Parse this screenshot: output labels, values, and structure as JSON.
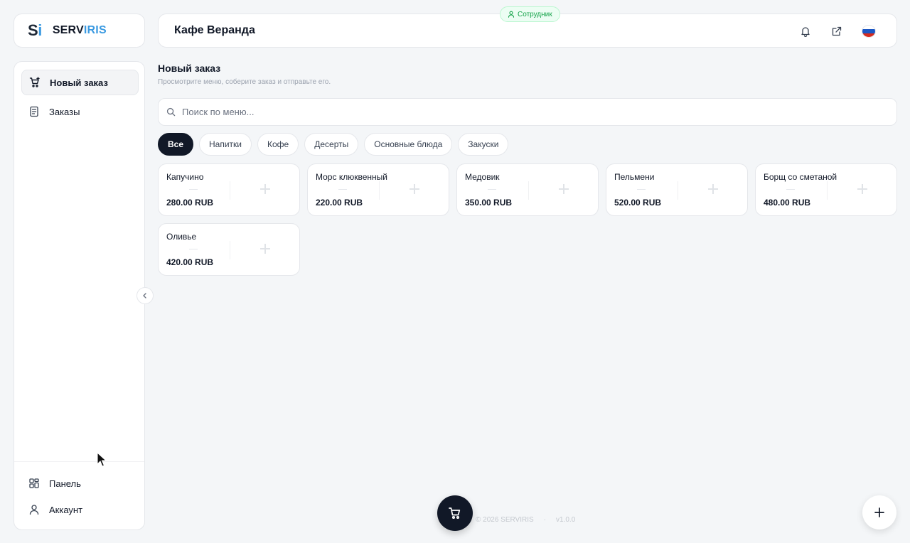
{
  "brand": {
    "mark_s": "S",
    "mark_i": "i",
    "name_a": "SERV",
    "name_b": "IRIS",
    "accent": "#3b9ae1"
  },
  "sidebar": {
    "items": [
      {
        "label": "Новый заказ",
        "icon": "cart-plus-icon",
        "active": true
      },
      {
        "label": "Заказы",
        "icon": "receipt-icon",
        "active": false
      }
    ],
    "bottom_items": [
      {
        "label": "Панель",
        "icon": "dashboard-icon"
      },
      {
        "label": "Аккаунт",
        "icon": "user-icon"
      }
    ]
  },
  "header": {
    "title": "Кафе Веранда",
    "role_badge": "Сотрудник",
    "icons": [
      "bell-icon",
      "external-link-icon",
      "russia-flag-icon"
    ]
  },
  "page": {
    "title": "Новый заказ",
    "subtitle": "Просмотрите меню, соберите заказ и отправьте его."
  },
  "search": {
    "placeholder": "Поиск по меню...",
    "value": ""
  },
  "categories": [
    {
      "label": "Все",
      "active": true
    },
    {
      "label": "Напитки",
      "active": false
    },
    {
      "label": "Кофе",
      "active": false
    },
    {
      "label": "Десерты",
      "active": false
    },
    {
      "label": "Основные блюда",
      "active": false
    },
    {
      "label": "Закуски",
      "active": false
    }
  ],
  "menu_items": [
    {
      "name": "Капучино",
      "price": "280.00 RUB"
    },
    {
      "name": "Морс клюквенный",
      "price": "220.00 RUB"
    },
    {
      "name": "Медовик",
      "price": "350.00 RUB"
    },
    {
      "name": "Пельмени",
      "price": "520.00 RUB"
    },
    {
      "name": "Борщ со сметаной",
      "price": "480.00 RUB"
    },
    {
      "name": "Оливье",
      "price": "420.00 RUB"
    }
  ],
  "footer": {
    "copyright": "© 2026 SERVIRIS",
    "separator": "·",
    "version": "v1.0.0"
  },
  "colors": {
    "dark": "#111827",
    "badge_green": "#16a34a",
    "background": "#f4f6f8"
  }
}
